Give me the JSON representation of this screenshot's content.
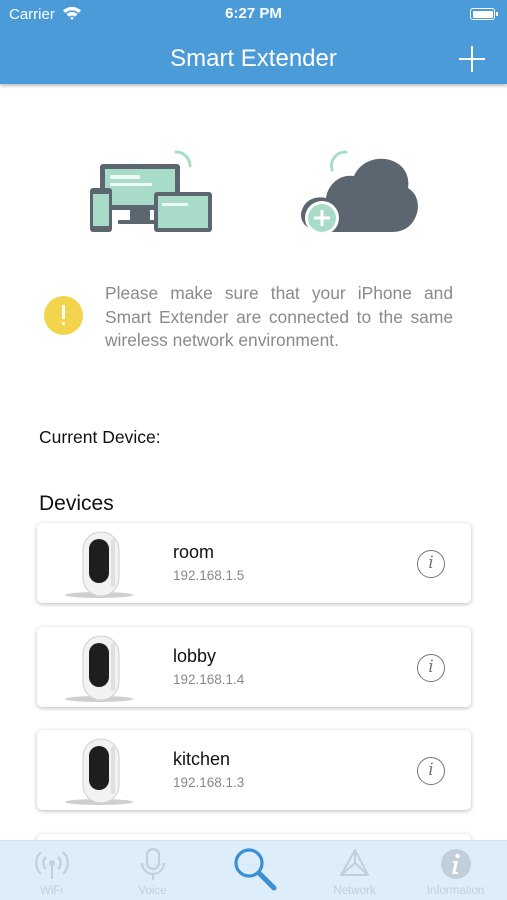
{
  "status_bar": {
    "carrier": "Carrier",
    "time": "6:27 PM"
  },
  "header": {
    "title": "Smart Extender",
    "add_icon": "plus-icon"
  },
  "illustrations": {
    "left": "devices-screens-illustration",
    "right": "cloud-plus-illustration"
  },
  "notice": {
    "icon": "warning-icon",
    "text": "Please make sure that your iPhone and Smart Extender are connected to the same wireless network environment."
  },
  "current_device_label": "Current Device:",
  "devices_title": "Devices",
  "devices": [
    {
      "name": "room",
      "ip": "192.168.1.5"
    },
    {
      "name": "lobby",
      "ip": "192.168.1.4"
    },
    {
      "name": "kitchen",
      "ip": "192.168.1.3"
    }
  ],
  "tabs": [
    {
      "label": "WiFi",
      "icon": "wifi-signal-icon",
      "active": false
    },
    {
      "label": "Voice",
      "icon": "microphone-icon",
      "active": false
    },
    {
      "label": "",
      "icon": "search-icon",
      "active": true
    },
    {
      "label": "Network",
      "icon": "network-icon",
      "active": false
    },
    {
      "label": "Information",
      "icon": "info-icon",
      "active": false
    }
  ],
  "colors": {
    "header": "#4a9bd8",
    "accent": "#3b8fd3",
    "warning": "#f3d44d",
    "illustration_dark": "#5c6670",
    "illustration_light": "#a8dcc9"
  }
}
